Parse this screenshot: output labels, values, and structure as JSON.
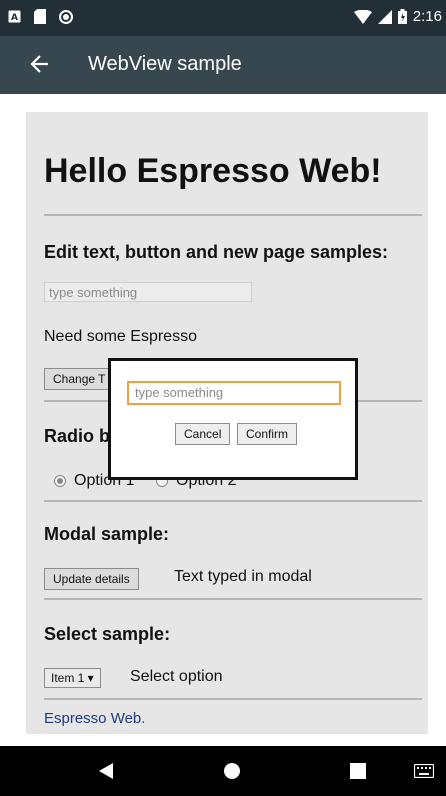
{
  "status_bar": {
    "time": "2:16",
    "icons": [
      "notification-a-icon",
      "sd-card-icon",
      "record-icon",
      "wifi-icon",
      "signal-icon",
      "battery-icon"
    ]
  },
  "app_bar": {
    "title": "WebView sample",
    "back_icon": "arrow-back-icon"
  },
  "web": {
    "heading": "Hello Espresso Web!",
    "edit_section_title": "Edit text, button and new page samples:",
    "text_input_placeholder": "type something",
    "need_text": "Need some Espresso",
    "change_button_label": "Change T",
    "radio_section_title": "Radio b",
    "radio_options": [
      {
        "label": "Option 1",
        "checked": true
      },
      {
        "label": "Option 2",
        "checked": false
      }
    ],
    "modal_section_title": "Modal sample:",
    "update_details_label": "Update details",
    "typed_in_modal": "Text typed in modal",
    "select_section_title": "Select sample:",
    "select_value": "Item 1 ▾",
    "select_option_text": "Select option",
    "footer_link": "Espresso Web."
  },
  "modal": {
    "input_placeholder": "type something",
    "cancel_label": "Cancel",
    "confirm_label": "Confirm"
  },
  "nav_bar": {
    "icons": [
      "back-triangle-icon",
      "home-circle-icon",
      "recents-square-icon",
      "keyboard-icon"
    ]
  },
  "colors": {
    "status_bar": "#232f36",
    "app_bar": "#37474f",
    "web_bg": "#e6e6e6",
    "modal_focus": "#f0a040",
    "link": "#1f3b80"
  }
}
